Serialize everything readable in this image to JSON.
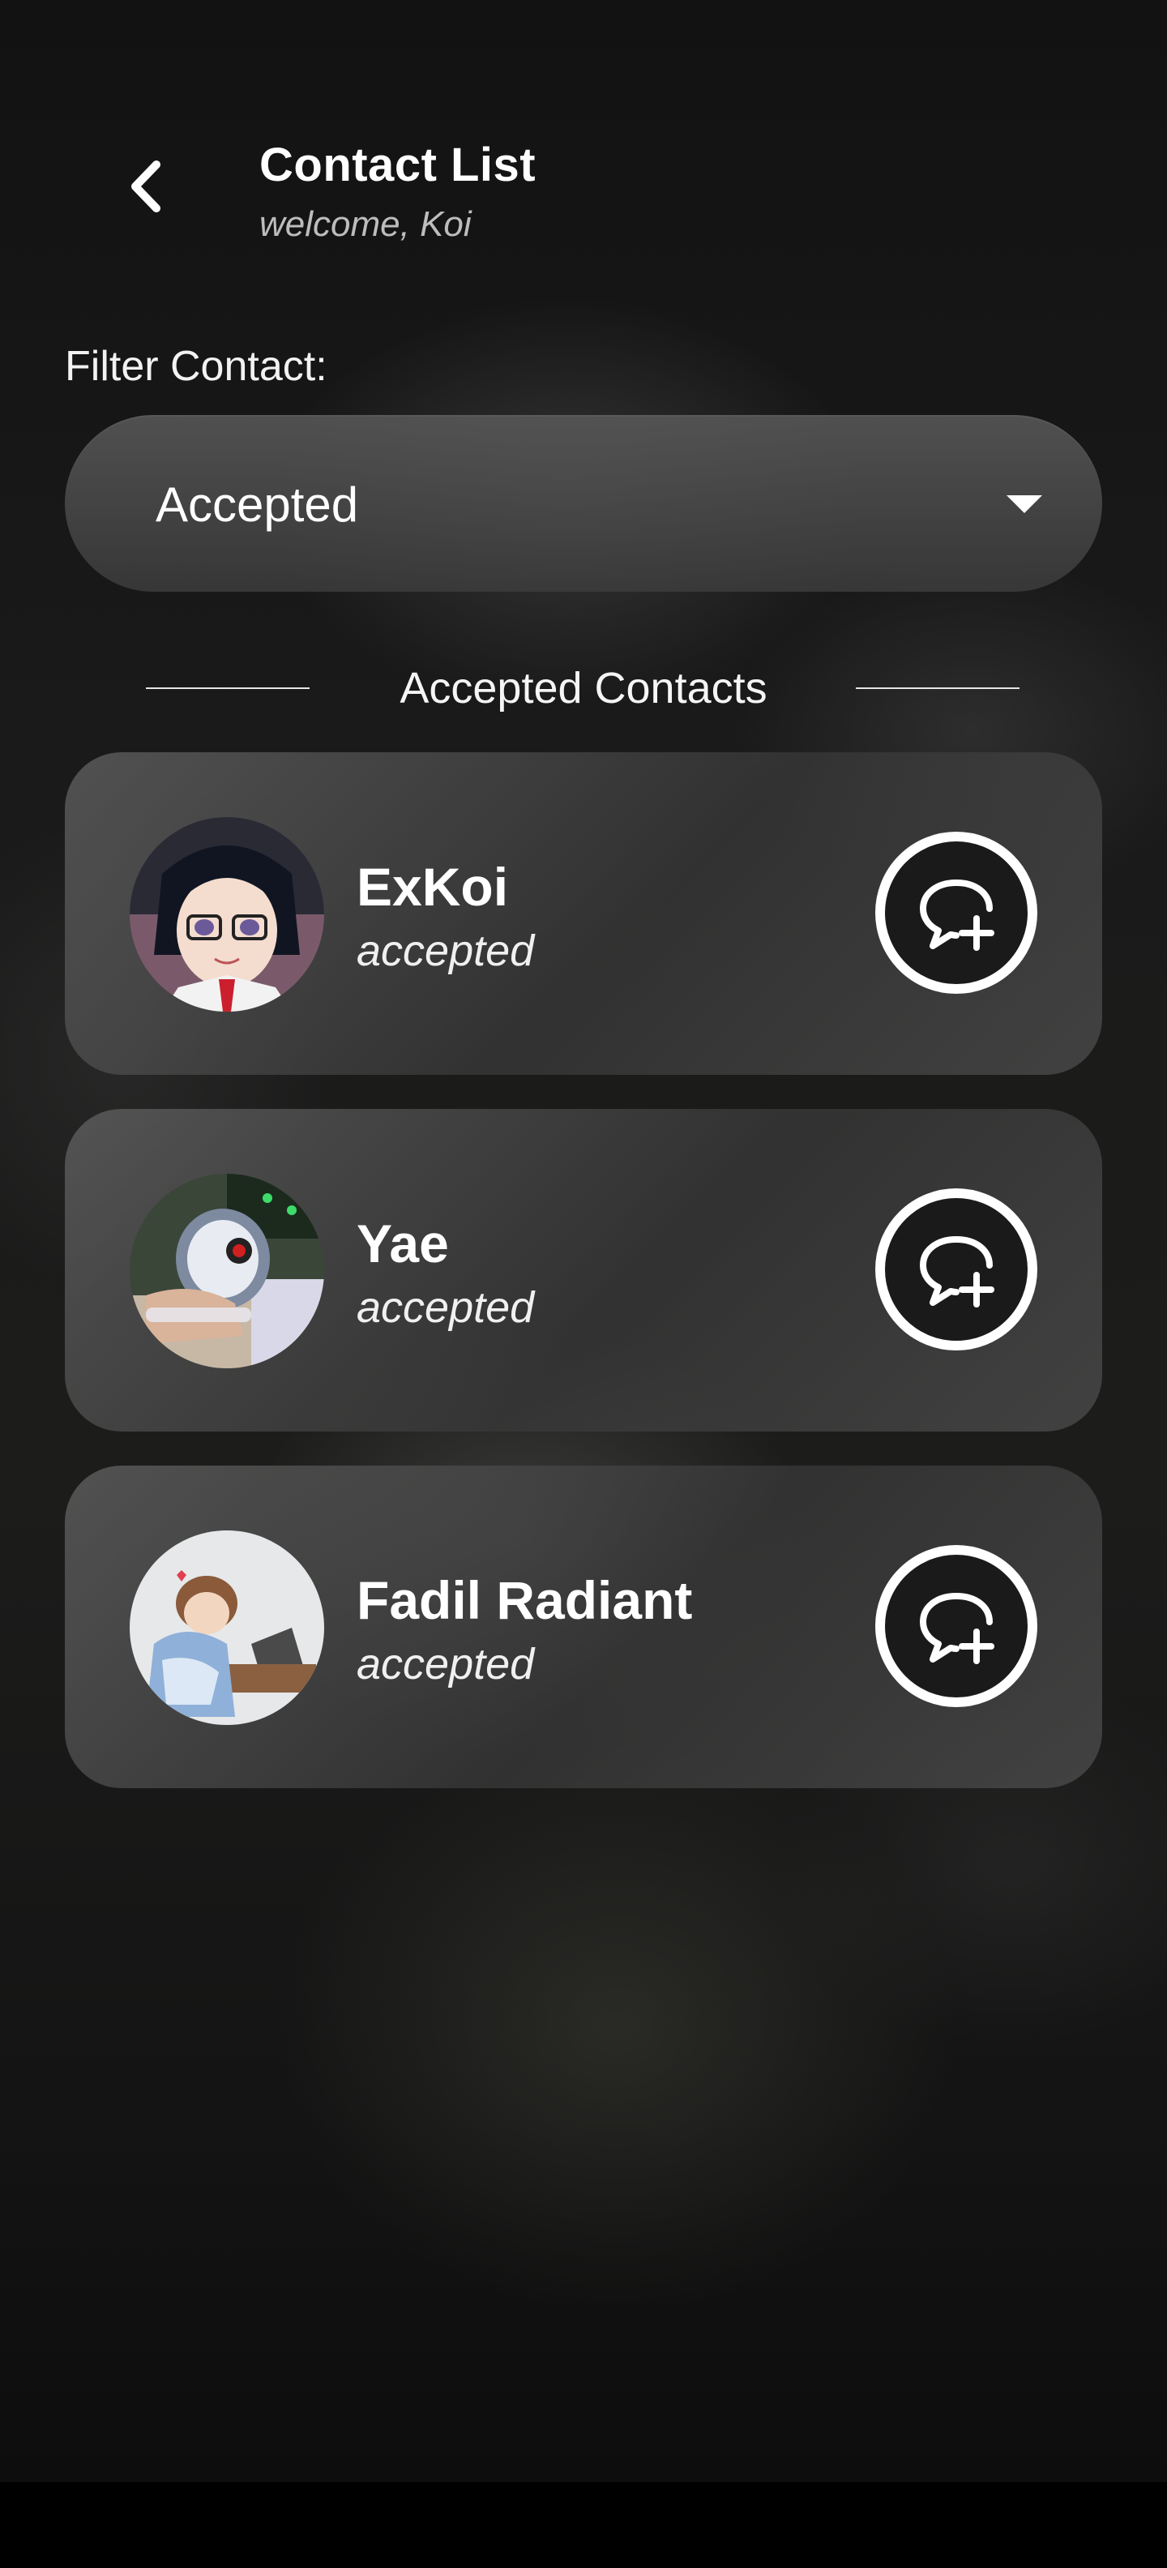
{
  "header": {
    "title": "Contact List",
    "subtitle": "welcome, Koi",
    "back_icon": "chevron-left-icon"
  },
  "filter": {
    "label": "Filter Contact:",
    "selected": "Accepted",
    "caret_icon": "caret-down-icon"
  },
  "section": {
    "title": "Accepted Contacts"
  },
  "contacts": [
    {
      "name": "ExKoi",
      "status": "accepted",
      "action_icon": "chat-add-icon"
    },
    {
      "name": "Yae",
      "status": "accepted",
      "action_icon": "chat-add-icon"
    },
    {
      "name": "Fadil Radiant",
      "status": "accepted",
      "action_icon": "chat-add-icon"
    }
  ],
  "colors": {
    "background": "#141414",
    "card": "#4a4a4a",
    "text": "#ffffff",
    "subtitle": "#bdbdbd",
    "nav_bar": "#000000"
  }
}
